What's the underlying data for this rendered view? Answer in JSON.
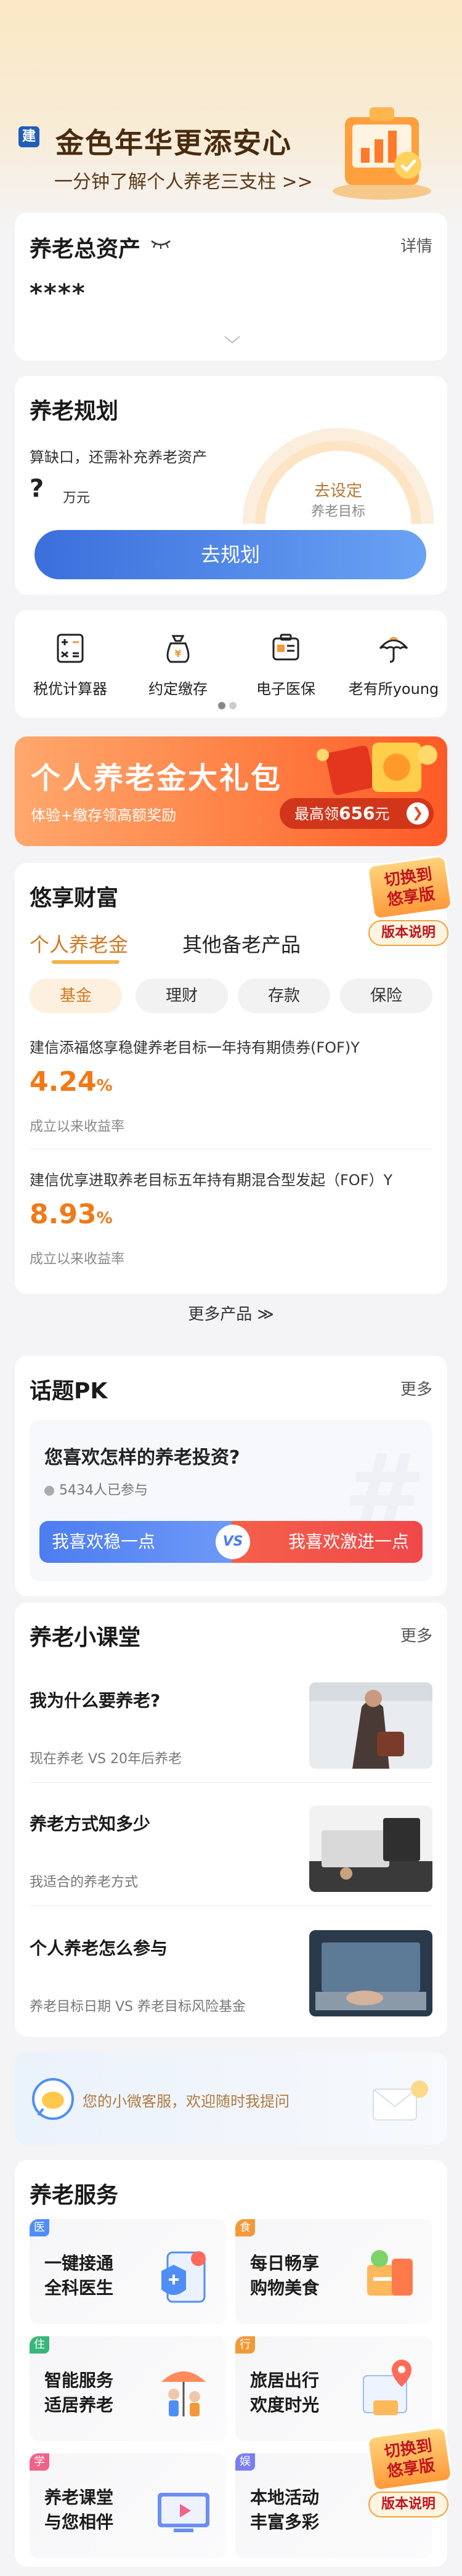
{
  "hero": {
    "logo_char": "建",
    "title": "金色年华更添安心",
    "subtitle": "一分钟了解个人养老三支柱 >>"
  },
  "assets": {
    "title": "养老总资产",
    "detail_link": "详情",
    "masked_value": "****"
  },
  "plan": {
    "title": "养老规划",
    "gap_text": "算缺口，还需补充养老资产",
    "amount_placeholder": "?",
    "unit": "万元",
    "ring_action": "去设定",
    "ring_label": "养老目标",
    "button_label": "去规划"
  },
  "tools": [
    {
      "label": "税优计算器",
      "icon": "calculator-icon"
    },
    {
      "label": "约定缴存",
      "icon": "money-bag-icon"
    },
    {
      "label": "电子医保",
      "icon": "medical-card-icon"
    },
    {
      "label": "老有所young",
      "icon": "umbrella-icon"
    }
  ],
  "banner": {
    "title": "个人养老金大礼包",
    "subtitle": "体验+缴存领高额奖励",
    "pill_prefix": "最高领",
    "pill_amount": "656",
    "pill_suffix": "元",
    "arrow": "❯"
  },
  "wealth": {
    "title": "悠享财富",
    "tabs": [
      "个人养老金",
      "其他备老产品"
    ],
    "categories": [
      "基金",
      "理财",
      "存款",
      "保险"
    ],
    "products": [
      {
        "name": "建信添福悠享稳健养老目标一年持有期债券(FOF)Y",
        "rate": "4.24",
        "rate_unit": "%",
        "note": "成立以来收益率"
      },
      {
        "name": "建信优享进取养老目标五年持有期混合型发起（FOF）Y",
        "rate": "8.93",
        "rate_unit": "%",
        "note": "成立以来收益率"
      }
    ],
    "more_label": "更多产品",
    "more_arrow": "≫"
  },
  "float_badge": {
    "line1": "切换到",
    "line2": "悠享版",
    "button": "版本说明"
  },
  "pk": {
    "title": "话题PK",
    "more": "更多",
    "question": "您喜欢怎样的养老投资?",
    "participants": "5434人已参与",
    "left_option": "我喜欢稳一点",
    "right_option": "我喜欢激进一点",
    "vs": "VS",
    "hash": "#"
  },
  "classroom": {
    "title": "养老小课堂",
    "more": "更多",
    "lessons": [
      {
        "title": "我为什么要养老?",
        "subtitle": "现在养老 VS 20年后养老"
      },
      {
        "title": "养老方式知多少",
        "subtitle": "我适合的养老方式"
      },
      {
        "title": "个人养老怎么参与",
        "subtitle": "养老目标日期 VS 养老目标风险基金"
      }
    ]
  },
  "customer_service": {
    "text": "您的小微客服，欢迎随时我提问"
  },
  "services": {
    "title": "养老服务",
    "items": [
      {
        "tag": "医",
        "tag_color": "#4f8ef7",
        "line1": "一键接通",
        "line2": "全科医生"
      },
      {
        "tag": "食",
        "tag_color": "#f29a38",
        "line1": "每日畅享",
        "line2": "购物美食"
      },
      {
        "tag": "住",
        "tag_color": "#39b77a",
        "line1": "智能服务",
        "line2": "适居养老"
      },
      {
        "tag": "行",
        "tag_color": "#f29a38",
        "line1": "旅居出行",
        "line2": "欢度时光"
      },
      {
        "tag": "学",
        "tag_color": "#f0628a",
        "line1": "养老课堂",
        "line2": "与您相伴"
      },
      {
        "tag": "娱",
        "tag_color": "#7a7df2",
        "line1": "本地活动",
        "line2": "丰富多彩"
      }
    ]
  },
  "colors": {
    "accent_orange": "#f07a18",
    "primary_blue": "#3b6fdc",
    "gold_text": "#4a2a0e"
  }
}
